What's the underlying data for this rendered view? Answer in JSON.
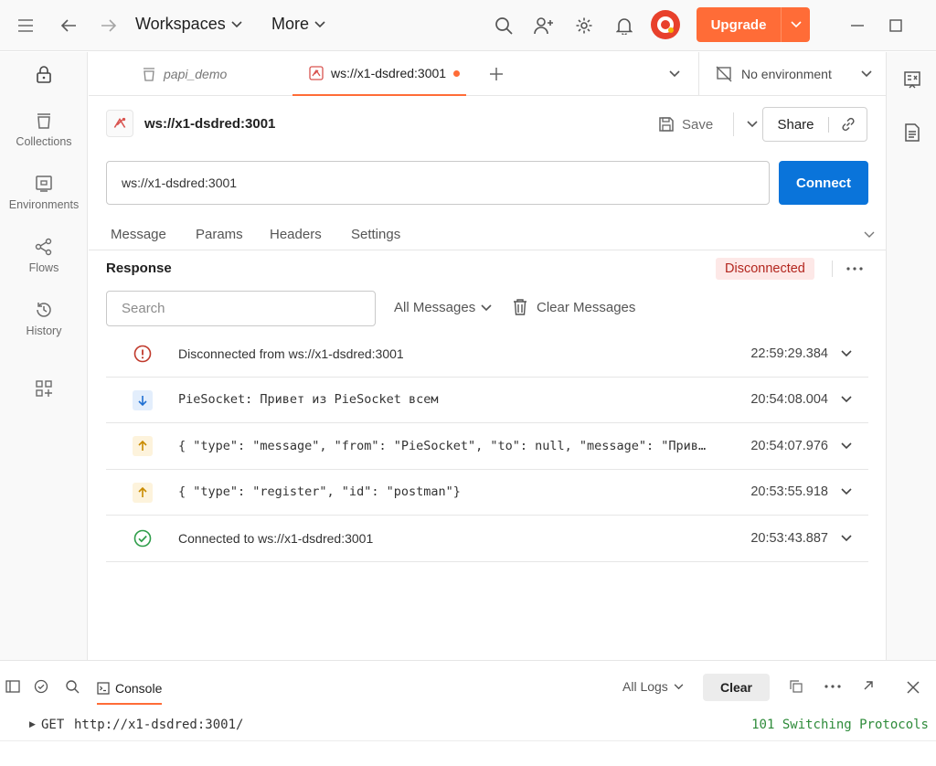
{
  "topbar": {
    "workspaces_label": "Workspaces",
    "more_label": "More",
    "upgrade_label": "Upgrade",
    "accent": "#ff6c37"
  },
  "sidebar": {
    "items": [
      {
        "label": "Collections"
      },
      {
        "label": "Environments"
      },
      {
        "label": "Flows"
      },
      {
        "label": "History"
      }
    ]
  },
  "tabs": [
    {
      "label": "papi_demo"
    },
    {
      "label": "ws://x1-dsdred:3001"
    }
  ],
  "environment": {
    "label": "No environment"
  },
  "request": {
    "title": "ws://x1-dsdred:3001",
    "save_label": "Save",
    "share_label": "Share",
    "url": "ws://x1-dsdred:3001",
    "connect_label": "Connect",
    "connect_color": "#0a74da"
  },
  "subtabs": [
    "Message",
    "Params",
    "Headers",
    "Settings"
  ],
  "response": {
    "title": "Response",
    "status": "Disconnected",
    "search_placeholder": "Search",
    "filter_label": "All Messages",
    "clear_label": "Clear Messages",
    "messages": [
      {
        "kind": "error",
        "text": "Disconnected from ws://x1-dsdred:3001",
        "time": "22:59:29.384"
      },
      {
        "kind": "incoming",
        "text": "PieSocket: Привет из PieSocket всем",
        "time": "20:54:08.004"
      },
      {
        "kind": "outgoing",
        "text": "{ \"type\": \"message\", \"from\": \"PieSocket\", \"to\": null, \"message\": \"Привет из PieSocket всем\" }",
        "time": "20:54:07.976"
      },
      {
        "kind": "outgoing",
        "text": "{ \"type\": \"register\", \"id\": \"postman\"}",
        "time": "20:53:55.918"
      },
      {
        "kind": "success",
        "text": "Connected to ws://x1-dsdred:3001",
        "time": "20:53:43.887"
      }
    ]
  },
  "console": {
    "tab_label": "Console",
    "logs_filter": "All Logs",
    "clear_label": "Clear",
    "entries": [
      {
        "method": "GET",
        "url": "http://x1-dsdred:3001/",
        "status": "101 Switching Protocols",
        "status_color": "#2e8b3a"
      }
    ]
  }
}
